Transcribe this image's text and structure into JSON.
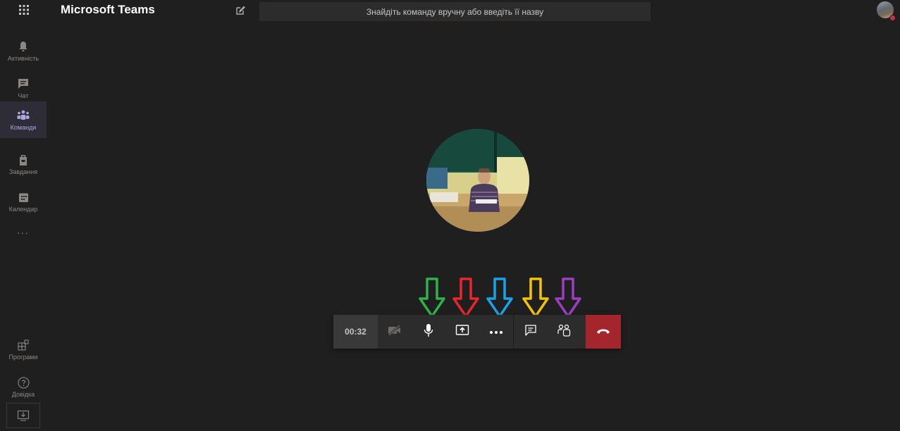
{
  "app": {
    "title": "Microsoft Teams",
    "search_placeholder": "Знайдіть команду вручну або введіть її назву"
  },
  "rail": {
    "items": [
      {
        "label": "Активність",
        "icon": "bell-icon"
      },
      {
        "label": "Чат",
        "icon": "chat-icon"
      },
      {
        "label": "Команди",
        "icon": "teams-icon",
        "active": true
      },
      {
        "label": "Завдання",
        "icon": "assignments-icon"
      },
      {
        "label": "Календар",
        "icon": "calendar-icon"
      }
    ],
    "more_label": "...",
    "bottom_items": [
      {
        "label": "Програми",
        "icon": "apps-icon"
      },
      {
        "label": "Довідка",
        "icon": "help-icon"
      }
    ]
  },
  "call": {
    "timer": "00:32",
    "controls": [
      "camera-off-icon",
      "microphone-icon",
      "share-screen-icon",
      "more-actions-icon",
      "chat-icon",
      "participants-icon",
      "hang-up-icon"
    ]
  },
  "colors": {
    "background": "#201f1f",
    "accent": "#a7a9e0",
    "hangup": "#a4262c",
    "arrow_mic": "#2db34a",
    "arrow_share": "#e8262b",
    "arrow_more": "#1aa3e8",
    "arrow_chat": "#f5c400",
    "arrow_participants": "#9b3fc0"
  }
}
